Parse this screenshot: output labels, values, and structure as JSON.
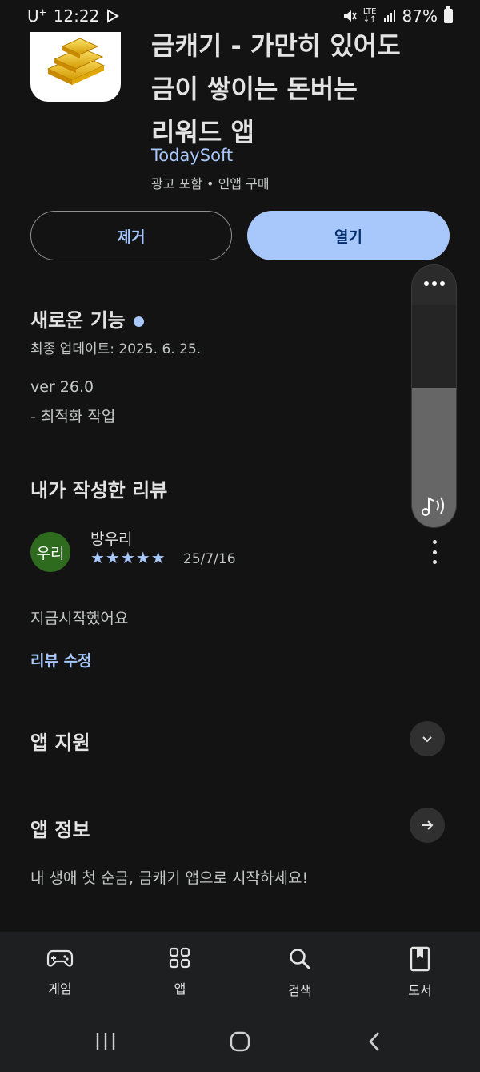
{
  "status_bar": {
    "carrier": "U",
    "carrier_sup": "+",
    "time": "12:22",
    "network": "LTE",
    "battery": "87%"
  },
  "app": {
    "title_lines": [
      "금캐기 - 가만히 있어도",
      "금이 쌓이는 돈버는",
      "리워드 앱"
    ],
    "developer": "TodaySoft",
    "meta": "광고 포함 • 인앱 구매"
  },
  "actions": {
    "remove_label": "제거",
    "open_label": "열기"
  },
  "whats_new": {
    "title": "새로운 기능",
    "updated": "최종 업데이트: 2025. 6. 25.",
    "version": "ver 26.0",
    "note": "- 최적화 작업"
  },
  "my_review": {
    "title": "내가 작성한 리뷰",
    "avatar_text": "우리",
    "reviewer": "방우리",
    "stars": "★★★★★",
    "rating": 5,
    "date": "25/7/16",
    "text": "지금시작했어요",
    "edit_label": "리뷰 수정"
  },
  "app_support": {
    "title": "앱 지원"
  },
  "app_info": {
    "title": "앱 정보",
    "description": "내 생애 첫 순금, 금캐기 앱으로 시작하세요!"
  },
  "volume": {
    "level": 0.63
  },
  "bottom_nav": {
    "items": [
      {
        "label": "게임",
        "icon": "gamepad-icon"
      },
      {
        "label": "앱",
        "icon": "apps-grid-icon"
      },
      {
        "label": "검색",
        "icon": "search-icon"
      },
      {
        "label": "도서",
        "icon": "book-icon"
      }
    ]
  },
  "colors": {
    "background": "#131314",
    "accent": "#a8c7fa",
    "avatar": "#2e6b1e"
  }
}
